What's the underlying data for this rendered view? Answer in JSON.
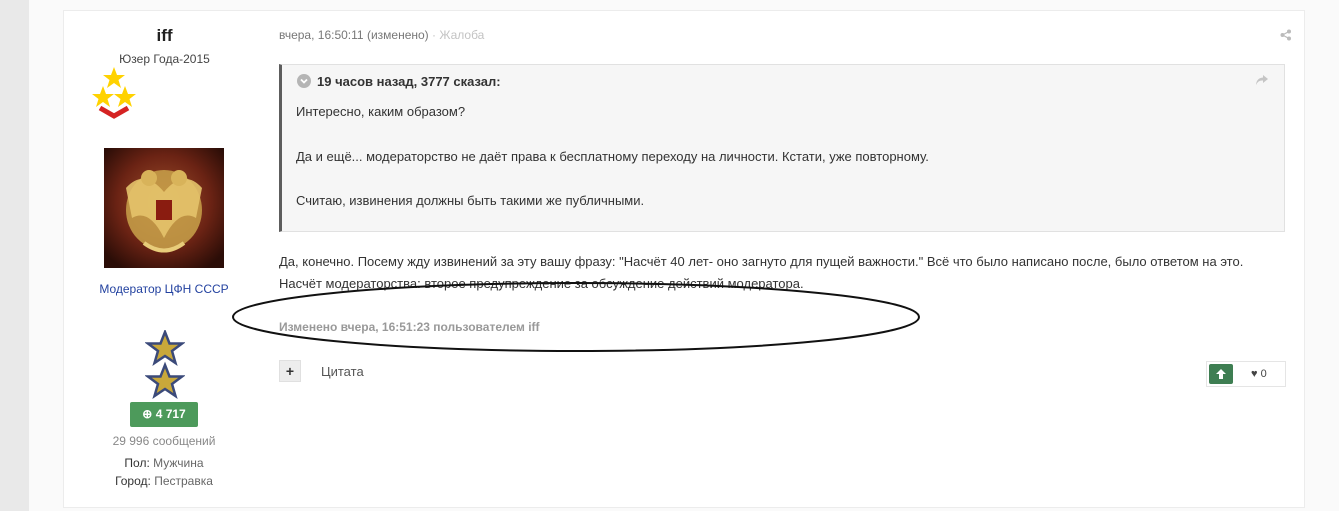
{
  "author": {
    "name": "iff",
    "rank_title": "Юзер Года-2015",
    "group": "Модератор ЦФН СССР",
    "reputation": "4 717",
    "post_count": "29 996 сообщений",
    "fields": [
      {
        "key": "Пол:",
        "value": "Мужчина"
      },
      {
        "key": "Город:",
        "value": "Пестравка"
      }
    ]
  },
  "post": {
    "date": "вчера, 16:50:11",
    "edited_flag": "(изменено)",
    "separator": "·",
    "report": "Жалоба",
    "quote": {
      "header": "19 часов назад, 3777 сказал:",
      "lines": [
        "Интересно, каким образом?",
        "Да и ещё...  модераторство не даёт права к бесплатному  переходу на личности. Кстати, уже повторному.",
        "Считаю, извинения должны быть такими же публичными."
      ]
    },
    "paragraphs": [
      "Да, конечно. Посему жду извинений за эту вашу фразу: \"Насчёт 40 лет- оно загнуто для пущей важности.\" Всё что было написано после, было ответом на это.",
      "Насчёт модераторства: второе предупреждение за обсуждение действий модератора."
    ],
    "edited_note": "Изменено вчера, 16:51:23 пользователем iff"
  },
  "actions": {
    "multiquote": "+",
    "quote_label": "Цитата",
    "like_count": "0"
  },
  "icons": {
    "share": "share-icon",
    "toggle": "chevron-down-icon",
    "upvote": "arrow-up-icon",
    "heart": "heart-icon",
    "plus": "plus-circle-icon"
  },
  "colors": {
    "reputation_bg": "#4d9a5b",
    "group_link": "#2342a0",
    "upvote_bg": "#3e7e52"
  }
}
